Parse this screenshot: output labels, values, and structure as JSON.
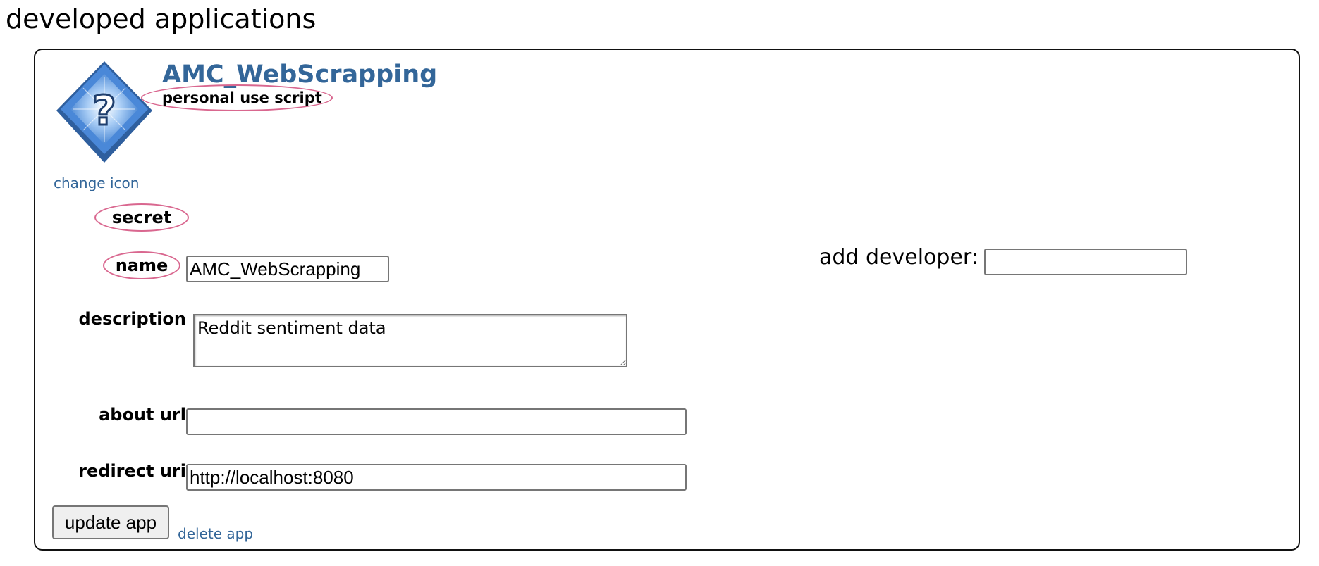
{
  "page": {
    "heading": "developed applications"
  },
  "app": {
    "title": "AMC_WebScrapping",
    "type": "personal use script",
    "icon": "question-mark-diamond-icon",
    "change_icon_label": "change icon",
    "secret_label": "secret",
    "fields": {
      "name": {
        "label": "name",
        "value": "AMC_WebScrapping"
      },
      "description": {
        "label": "description",
        "value": "Reddit sentiment data"
      },
      "about_url": {
        "label": "about url",
        "value": ""
      },
      "redirect_uri": {
        "label": "redirect uri",
        "value": "http://localhost:8080"
      }
    },
    "add_developer": {
      "label": "add developer:",
      "value": ""
    },
    "update_button_label": "update app",
    "delete_link_label": "delete app"
  },
  "colors": {
    "link": "#336699",
    "highlight_ellipse": "#d9678f",
    "icon_blue": "#3d77c9"
  }
}
